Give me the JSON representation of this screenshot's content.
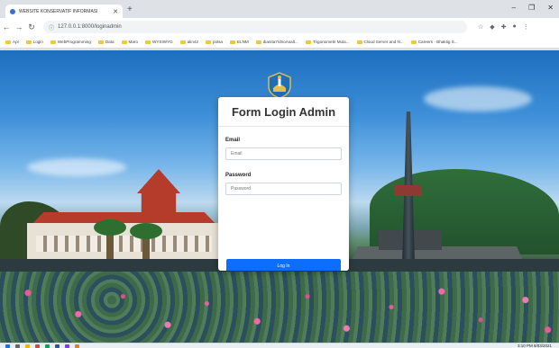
{
  "browser": {
    "tab": {
      "title": "WEBSITE KONSERVATIF INFORMASI",
      "icon": "globe-icon"
    },
    "new_tab_label": "+",
    "address": "127.0.0.1:8000/loginadmin",
    "window_controls": [
      "–",
      "❐",
      "✕"
    ],
    "bookmarks": [
      "Apl",
      "Login",
      "WebProgramming",
      "Data",
      "Maro",
      "WYSIWYG",
      "alin42",
      "polsa",
      "ELNM",
      "dianita7/dnoAsalt...",
      "Trigonometri Mula...",
      "Cloud Server and N...",
      "Careers - Bhaktig S..."
    ]
  },
  "login": {
    "title": "Form Login Admin",
    "email_label": "Email",
    "email_placeholder": "Email",
    "password_label": "Password",
    "password_placeholder": "Password",
    "submit_label": "Log In"
  },
  "taskbar": {
    "time": "3:10 PM",
    "date": "8/03/2021"
  },
  "colors": {
    "primary_button": "#0d6efd",
    "browser_frame": "#dee1e6"
  }
}
